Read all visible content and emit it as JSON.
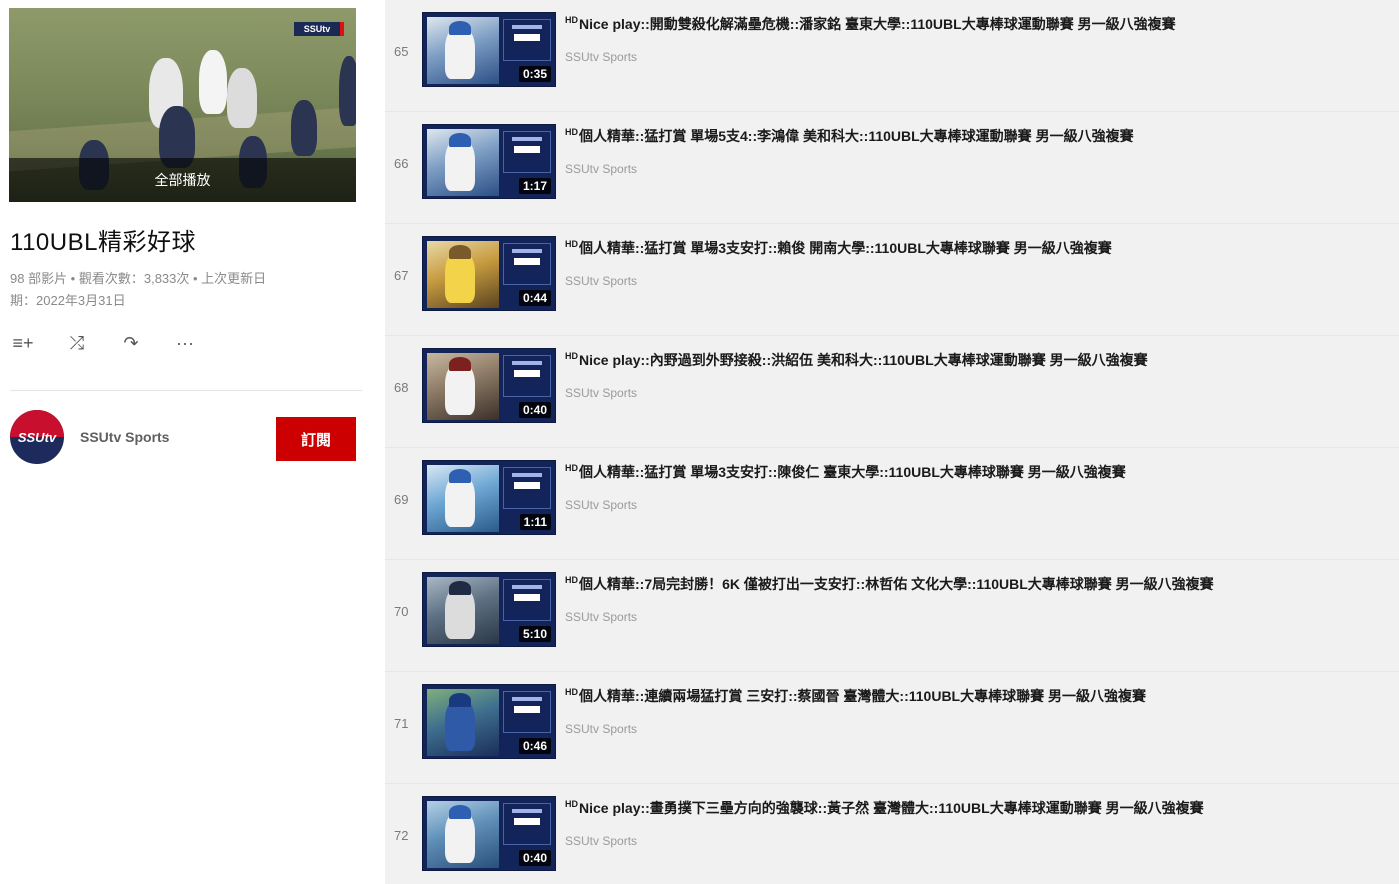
{
  "playlist": {
    "play_all_label": "全部播放",
    "title": "110UBL精彩好球",
    "meta_line1": "98 部影片 • 觀看次數：3,833次 • 上次更新日",
    "meta_line2": "期：2022年3月31日",
    "owner": {
      "avatar_text": "SSUtv",
      "name": "SSUtv Sports"
    },
    "subscribe_label": "訂閱",
    "hero_logo_text": "SSUtv"
  },
  "actions": [
    {
      "icon": "add-to-queue-icon",
      "glyph": "≡+"
    },
    {
      "icon": "shuffle-icon",
      "glyph": "⤮"
    },
    {
      "icon": "share-icon",
      "glyph": "↷"
    },
    {
      "icon": "more-icon",
      "glyph": "···"
    }
  ],
  "videos": [
    {
      "index": "65",
      "hd": "HD",
      "title": "Nice play::開動雙殺化解滿壘危機::潘家銘 臺東大學::110UBL大專棒球運動聯賽 男一級八強複賽",
      "channel": "SSUtv Sports",
      "duration": "0:35"
    },
    {
      "index": "66",
      "hd": "HD",
      "title": "個人精華::猛打賞 單場5支4::李鴻偉 美和科大::110UBL大專棒球運動聯賽 男一級八強複賽",
      "channel": "SSUtv Sports",
      "duration": "1:17"
    },
    {
      "index": "67",
      "hd": "HD",
      "title": "個人精華::猛打賞 單場3支安打::賴俊 開南大學::110UBL大專棒球聯賽 男一級八強複賽",
      "channel": "SSUtv Sports",
      "duration": "0:44"
    },
    {
      "index": "68",
      "hd": "HD",
      "title": "Nice play::內野過到外野接殺::洪紹伍 美和科大::110UBL大專棒球運動聯賽 男一級八強複賽",
      "channel": "SSUtv Sports",
      "duration": "0:40"
    },
    {
      "index": "69",
      "hd": "HD",
      "title": "個人精華::猛打賞 單場3支安打::陳俊仁 臺東大學::110UBL大專棒球聯賽 男一級八強複賽",
      "channel": "SSUtv Sports",
      "duration": "1:11"
    },
    {
      "index": "70",
      "hd": "HD",
      "title": "個人精華::7局完封勝！6K 僅被打出一支安打::林哲佑 文化大學::110UBL大專棒球聯賽 男一級八強複賽",
      "channel": "SSUtv Sports",
      "duration": "5:10"
    },
    {
      "index": "71",
      "hd": "HD",
      "title": "個人精華::連續兩場猛打賞 三安打::蔡國晉 臺灣體大::110UBL大專棒球聯賽 男一級八強複賽",
      "channel": "SSUtv Sports",
      "duration": "0:46"
    },
    {
      "index": "72",
      "hd": "HD",
      "title": "Nice play::畫勇撲下三壘方向的強襲球::黃子然 臺灣體大::110UBL大專棒球運動聯賽 男一級八強複賽",
      "channel": "SSUtv Sports",
      "duration": "0:40"
    }
  ],
  "colors": {
    "subscribe_bg": "#cc0000",
    "thumb_bg": "#13245a",
    "list_bg": "#f1f1f1"
  }
}
